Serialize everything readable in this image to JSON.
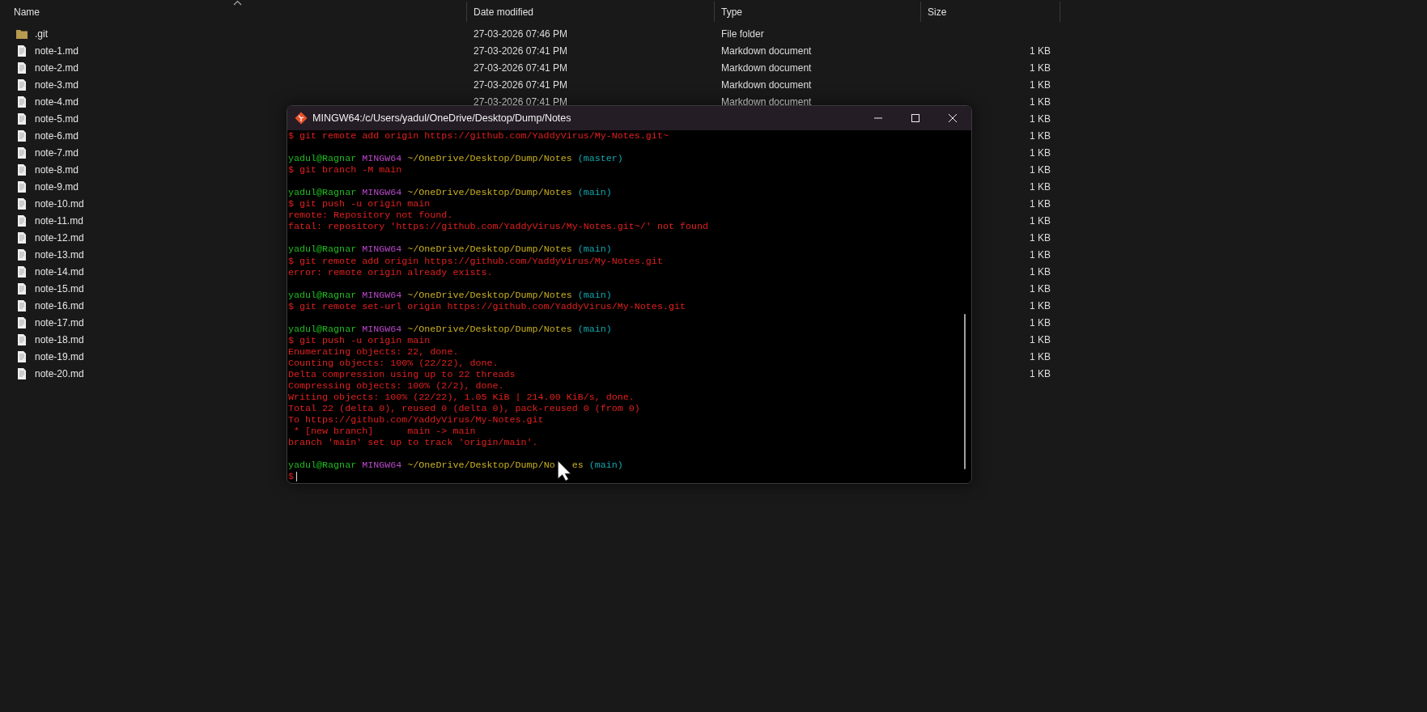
{
  "explorer": {
    "columns": [
      "Name",
      "Date modified",
      "Type",
      "Size"
    ],
    "files": [
      {
        "name": ".git",
        "kind": "folder",
        "date": "27-03-2026 07:46 PM",
        "type": "File folder"
      },
      {
        "name": "note-1.md",
        "kind": "file",
        "date": "27-03-2026 07:41 PM",
        "type": "Markdown document",
        "size": "1 KB"
      },
      {
        "name": "note-2.md",
        "kind": "file",
        "date": "27-03-2026 07:41 PM",
        "type": "Markdown document",
        "size": "1 KB"
      },
      {
        "name": "note-3.md",
        "kind": "file",
        "date": "27-03-2026 07:41 PM",
        "type": "Markdown document",
        "size": "1 KB"
      },
      {
        "name": "note-4.md",
        "kind": "file",
        "date": "27-03-2026 07:41 PM",
        "type": "Markdown document",
        "size": "1 KB"
      },
      {
        "name": "note-5.md",
        "kind": "file",
        "size": "1 KB"
      },
      {
        "name": "note-6.md",
        "kind": "file",
        "size": "1 KB"
      },
      {
        "name": "note-7.md",
        "kind": "file",
        "size": "1 KB"
      },
      {
        "name": "note-8.md",
        "kind": "file",
        "size": "1 KB"
      },
      {
        "name": "note-9.md",
        "kind": "file",
        "size": "1 KB"
      },
      {
        "name": "note-10.md",
        "kind": "file",
        "size": "1 KB"
      },
      {
        "name": "note-11.md",
        "kind": "file",
        "size": "1 KB"
      },
      {
        "name": "note-12.md",
        "kind": "file",
        "size": "1 KB"
      },
      {
        "name": "note-13.md",
        "kind": "file",
        "size": "1 KB"
      },
      {
        "name": "note-14.md",
        "kind": "file",
        "size": "1 KB"
      },
      {
        "name": "note-15.md",
        "kind": "file",
        "size": "1 KB"
      },
      {
        "name": "note-16.md",
        "kind": "file",
        "size": "1 KB"
      },
      {
        "name": "note-17.md",
        "kind": "file",
        "size": "1 KB"
      },
      {
        "name": "note-18.md",
        "kind": "file",
        "size": "1 KB"
      },
      {
        "name": "note-19.md",
        "kind": "file",
        "size": "1 KB"
      },
      {
        "name": "note-20.md",
        "kind": "file",
        "size": "1 KB"
      }
    ]
  },
  "terminal": {
    "title": "MINGW64:/c/Users/yadul/OneDrive/Desktop/Dump/Notes",
    "lines": [
      {
        "kind": "output",
        "text": "$ git remote add origin https://github.com/YaddyVirus/My-Notes.git~"
      },
      {
        "kind": "blank"
      },
      {
        "kind": "prompt",
        "user": "yadul@Ragnar",
        "host": "MINGW64",
        "path": "~/OneDrive/Desktop/Dump/Notes",
        "branch": "(master)"
      },
      {
        "kind": "output",
        "text": "$ git branch -M main"
      },
      {
        "kind": "blank"
      },
      {
        "kind": "prompt",
        "user": "yadul@Ragnar",
        "host": "MINGW64",
        "path": "~/OneDrive/Desktop/Dump/Notes",
        "branch": "(main)"
      },
      {
        "kind": "output",
        "text": "$ git push -u origin main"
      },
      {
        "kind": "output",
        "text": "remote: Repository not found."
      },
      {
        "kind": "output",
        "text": "fatal: repository 'https://github.com/YaddyVirus/My-Notes.git~/' not found"
      },
      {
        "kind": "blank"
      },
      {
        "kind": "prompt",
        "user": "yadul@Ragnar",
        "host": "MINGW64",
        "path": "~/OneDrive/Desktop/Dump/Notes",
        "branch": "(main)"
      },
      {
        "kind": "output",
        "text": "$ git remote add origin https://github.com/YaddyVirus/My-Notes.git"
      },
      {
        "kind": "output",
        "text": "error: remote origin already exists."
      },
      {
        "kind": "blank"
      },
      {
        "kind": "prompt",
        "user": "yadul@Ragnar",
        "host": "MINGW64",
        "path": "~/OneDrive/Desktop/Dump/Notes",
        "branch": "(main)"
      },
      {
        "kind": "output",
        "text": "$ git remote set-url origin https://github.com/YaddyVirus/My-Notes.git"
      },
      {
        "kind": "blank"
      },
      {
        "kind": "prompt",
        "user": "yadul@Ragnar",
        "host": "MINGW64",
        "path": "~/OneDrive/Desktop/Dump/Notes",
        "branch": "(main)"
      },
      {
        "kind": "output",
        "text": "$ git push -u origin main"
      },
      {
        "kind": "output",
        "text": "Enumerating objects: 22, done."
      },
      {
        "kind": "output",
        "text": "Counting objects: 100% (22/22), done."
      },
      {
        "kind": "output",
        "text": "Delta compression using up to 22 threads"
      },
      {
        "kind": "output",
        "text": "Compressing objects: 100% (2/2), done."
      },
      {
        "kind": "output",
        "text": "Writing objects: 100% (22/22), 1.05 KiB | 214.00 KiB/s, done."
      },
      {
        "kind": "output",
        "text": "Total 22 (delta 0), reused 0 (delta 0), pack-reused 0 (from 0)"
      },
      {
        "kind": "output",
        "text": "To https://github.com/YaddyVirus/My-Notes.git"
      },
      {
        "kind": "output",
        "text": " * [new branch]      main -> main"
      },
      {
        "kind": "output",
        "text": "branch 'main' set up to track 'origin/main'."
      },
      {
        "kind": "blank"
      },
      {
        "kind": "prompt",
        "user": "yadul@Ragnar",
        "host": "MINGW64",
        "path": "~/OneDrive/Desktop/Dump/No",
        "path_after": "es",
        "branch": "(main)"
      },
      {
        "kind": "input",
        "text": "$"
      }
    ]
  }
}
